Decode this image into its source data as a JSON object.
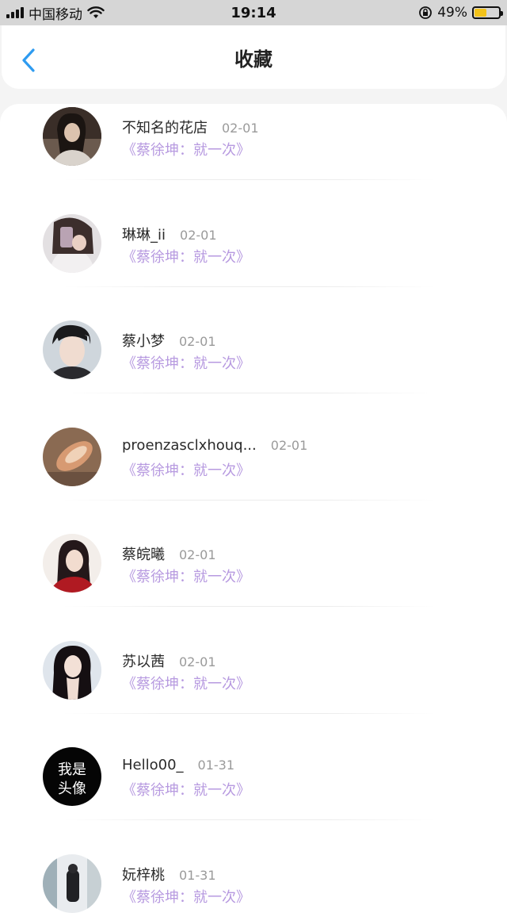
{
  "status_bar": {
    "carrier": "中国移动",
    "time": "19:14",
    "battery_percent": "49%",
    "battery_level": 0.49,
    "battery_color": "#f2c21a"
  },
  "header": {
    "title": "收藏",
    "back_icon": "chevron-left-icon",
    "accent": "#2e9bf0"
  },
  "favorites": [
    {
      "name": "不知名的花店",
      "date": "02-01",
      "song": "《蔡徐坤：就一次》"
    },
    {
      "name": "琳琳_ii",
      "date": "02-01",
      "song": "《蔡徐坤：就一次》"
    },
    {
      "name": "蔡小梦",
      "date": "02-01",
      "song": "《蔡徐坤：就一次》"
    },
    {
      "name": "proenzasclxhouq...",
      "date": "02-01",
      "song": "《蔡徐坤：就一次》"
    },
    {
      "name": "蔡皖曦",
      "date": "02-01",
      "song": "《蔡徐坤：就一次》"
    },
    {
      "name": "苏以茜",
      "date": "02-01",
      "song": "《蔡徐坤：就一次》"
    },
    {
      "name": "Hello00_",
      "date": "01-31",
      "song": "《蔡徐坤：就一次》"
    },
    {
      "name": "妧梓桃",
      "date": "01-31",
      "song": "《蔡徐坤：就一次》"
    }
  ],
  "avatar_text": "我是头像",
  "song_color": "#b79ae0"
}
